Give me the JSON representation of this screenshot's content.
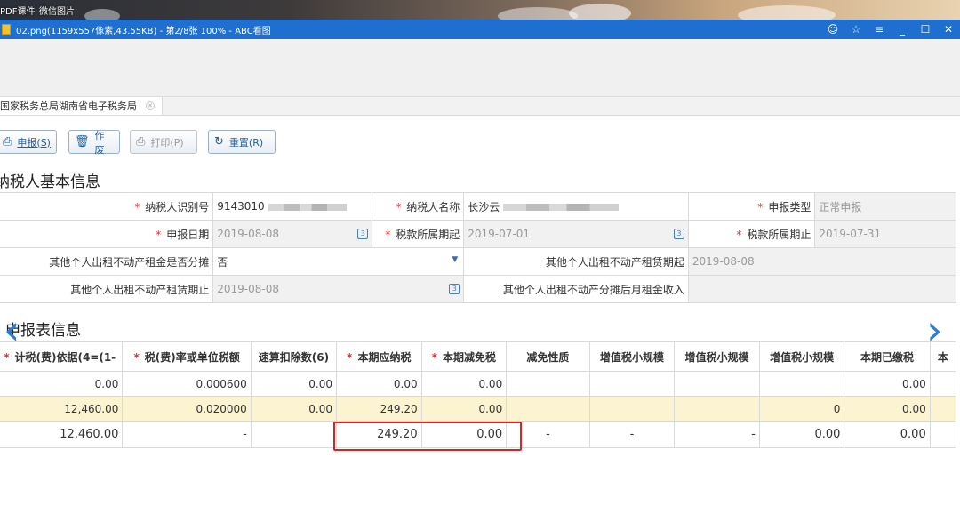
{
  "desktop": {
    "labels": [
      "PDF课件",
      "微信图片"
    ]
  },
  "window": {
    "title": "02.png(1159x557像素,43.55KB) - 第2/8张 100% - ABC看图"
  },
  "tab": {
    "label": "国家税务总局湖南省电子税务局"
  },
  "toolbar": {
    "declare": "申报(S)",
    "void": "作废",
    "print": "打印(P)",
    "reset": "重置(R)"
  },
  "basic_info": {
    "title": "纳税人基本信息",
    "taxpayer_id_label": "纳税人识别号",
    "taxpayer_id_value": "9143010",
    "taxpayer_name_label": "纳税人名称",
    "taxpayer_name_value": "长沙云",
    "decl_type_label": "申报类型",
    "decl_type_value": "正常申报",
    "decl_date_label": "申报日期",
    "decl_date_value": "2019-08-08",
    "period_start_label": "税款所属期起",
    "period_start_value": "2019-07-01",
    "period_end_label": "税款所属期止",
    "period_end_value": "2019-07-31",
    "rent_split_label": "其他个人出租不动产租金是否分摊",
    "rent_split_value": "否",
    "lease_start_label": "其他个人出租不动产租赁期起",
    "lease_start_value": "2019-08-08",
    "lease_end_label": "其他个人出租不动产租赁期止",
    "lease_end_value": "2019-08-08",
    "monthly_rent_label": "其他个人出租不动产分摊后月租金收入",
    "monthly_rent_value": ""
  },
  "report": {
    "title": "申报表信息",
    "headers": [
      "计税(费)依据(4=(1-",
      "税(费)率或单位税额",
      "速算扣除数(6)",
      "本期应纳税",
      "本期减免税",
      "减免性质",
      "增值税小规模",
      "增值税小规模",
      "增值税小规模",
      "本期已缴税",
      "本"
    ],
    "header_required": [
      true,
      true,
      false,
      true,
      true,
      false,
      false,
      false,
      false,
      false,
      false
    ],
    "rows": [
      [
        "0.00",
        "0.000600",
        "0.00",
        "0.00",
        "0.00",
        "",
        "",
        "",
        "",
        "0.00",
        ""
      ],
      [
        "12,460.00",
        "0.020000",
        "0.00",
        "249.20",
        "0.00",
        "",
        "",
        "",
        "0",
        "0.00",
        ""
      ],
      [
        "12,460.00",
        "-",
        "",
        "249.20",
        "0.00",
        "-",
        "-",
        "-",
        "0.00",
        "0.00",
        ""
      ]
    ]
  },
  "colors": {
    "titlebar": "#1e6fcf",
    "accent_arrow": "#2f7ad8",
    "required": "#e52a2a",
    "highlight_row": "#fcf3d1",
    "callout": "#e02020"
  }
}
